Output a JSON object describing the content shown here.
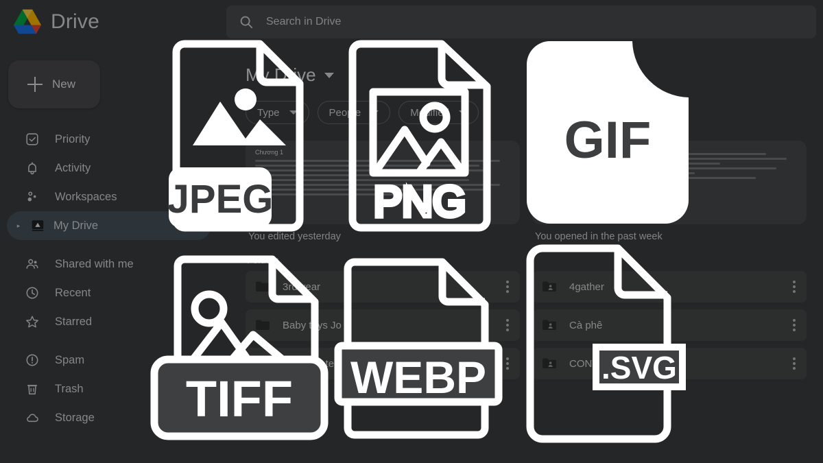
{
  "app": {
    "logo_icon": "google-drive-logo",
    "name": "Drive"
  },
  "search": {
    "icon": "search-icon",
    "placeholder": "Search in Drive",
    "value": ""
  },
  "sidebar": {
    "new_button": {
      "icon": "plus-icon",
      "label": "New"
    },
    "items": [
      {
        "icon": "priority-check-icon",
        "label": "Priority",
        "active": false
      },
      {
        "icon": "bell-icon",
        "label": "Activity",
        "active": false
      },
      {
        "icon": "workspaces-icon",
        "label": "Workspaces",
        "active": false
      },
      {
        "icon": "my-drive-icon",
        "label": "My Drive",
        "active": true
      },
      {
        "icon": "people-icon",
        "label": "Shared with me",
        "active": false
      },
      {
        "icon": "clock-icon",
        "label": "Recent",
        "active": false
      },
      {
        "icon": "star-icon",
        "label": "Starred",
        "active": false
      },
      {
        "icon": "exclamation-icon",
        "label": "Spam",
        "active": false
      },
      {
        "icon": "trash-icon",
        "label": "Trash",
        "active": false
      },
      {
        "icon": "cloud-icon",
        "label": "Storage",
        "active": false
      }
    ]
  },
  "main": {
    "page_title": "My Drive",
    "title_dropdown_icon": "chevron-down-icon",
    "filter_chips": [
      {
        "label": "Type",
        "icon": "chevron-down-icon"
      },
      {
        "label": "People",
        "icon": "chevron-down-icon"
      },
      {
        "label": "Modified",
        "icon": "chevron-down-icon"
      }
    ],
    "suggested": [
      {
        "doc_heading": "Chương 1",
        "caption": "You edited yesterday"
      },
      {
        "doc_heading": "",
        "caption": "You opened in the past week"
      }
    ],
    "folders_section_title": "Folders",
    "folders": [
      {
        "name": "3rd year",
        "icon": "folder-icon",
        "menu_icon": "kebab-menu-icon"
      },
      {
        "name": "4gather",
        "icon": "shared-folder-icon",
        "menu_icon": "kebab-menu-icon"
      },
      {
        "name": "Baby toys Jo",
        "icon": "folder-icon",
        "menu_icon": "kebab-menu-icon"
      },
      {
        "name": "Cà phê",
        "icon": "shared-folder-icon",
        "menu_icon": "kebab-menu-icon"
      },
      {
        "name": "Colab Notebooks",
        "icon": "folder-icon",
        "menu_icon": "kebab-menu-icon"
      },
      {
        "name": "CONTENTMEDIA",
        "icon": "shared-folder-icon",
        "menu_icon": "kebab-menu-icon"
      }
    ]
  },
  "format_icons": [
    {
      "label": "JPEG",
      "icon": "jpeg-file-icon",
      "style": "filled-banner"
    },
    {
      "label": "PNG",
      "icon": "png-file-icon",
      "style": "outline"
    },
    {
      "label": "GIF",
      "icon": "gif-file-icon",
      "style": "solid"
    },
    {
      "label": "TIFF",
      "icon": "tiff-file-icon",
      "style": "outline-banner"
    },
    {
      "label": "WEBP",
      "icon": "webp-file-icon",
      "style": "outline-wide-banner"
    },
    {
      "label": ".SVG",
      "icon": "svg-file-icon",
      "style": "outline-badge"
    }
  ],
  "colors": {
    "background": "#3f4042",
    "overlay_white": "#ffffff",
    "active_nav": "#47535c",
    "drive_blue": "#1a73e8",
    "drive_green": "#00ac47",
    "drive_yellow": "#ffba00",
    "drive_red": "#ea4335"
  }
}
